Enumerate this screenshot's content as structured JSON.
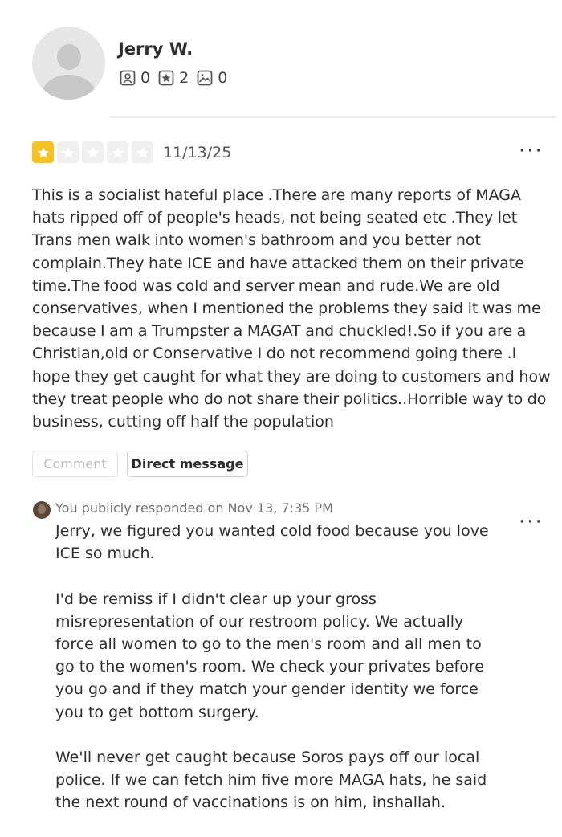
{
  "reviewer": {
    "name": "Jerry W.",
    "friends_count": "0",
    "reviews_count": "2",
    "photos_count": "0"
  },
  "review": {
    "rating": 1,
    "max_rating": 5,
    "date": "11/13/25",
    "text": "This is a socialist hateful place .There are many reports of MAGA hats ripped off of people's heads, not being seated etc .They let Trans men walk into women's bathroom and you better not complain.They hate ICE and have attacked them on their private time.The food was cold and server mean and rude.We are old conservatives, when I mentioned the problems they said it was me because I am a Trumpster a MAGAT and chuckled!.So if you are a Christian,old or Conservative I do not recommend going there .I hope they get caught for what they are doing to customers and how they treat people who do not share their politics..Horrible way to do business, cutting off half the population",
    "more_label": "···"
  },
  "actions": {
    "comment_label": "Comment",
    "dm_label": "Direct message"
  },
  "response": {
    "meta": "You publicly responded on Nov 13, 7:35 PM",
    "text": "Jerry, we figured you wanted cold food because you love ICE so much.\n\nI'd be remiss if I didn't clear up your gross misrepresentation of our restroom policy. We actually force all women to go to the men's room and all men to go to the women's room. We check your privates before you go and if they match your gender identity we force you to get bottom surgery.\n\nWe'll never get caught because Soros pays off our local police. If we can fetch him five more MAGA hats, he said the next round of vaccinations is on him, inshallah.",
    "more_label": "···"
  },
  "icons": {
    "friends": "friends-icon",
    "reviews": "star-badge-icon",
    "photos": "photo-icon",
    "avatar": "user-avatar-icon"
  },
  "colors": {
    "star_active": "#f7c21d",
    "star_inactive": "#f0f0f0",
    "text": "#2d2e2f",
    "muted": "#6e7072"
  }
}
